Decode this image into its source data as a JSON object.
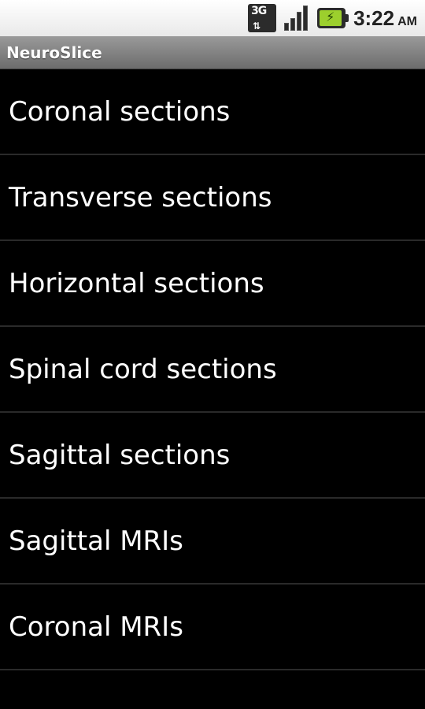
{
  "status_bar": {
    "network_label": "3G",
    "network_arrows": "⇅",
    "battery_bolt": "⚡",
    "time": "3:22",
    "ampm": "AM"
  },
  "app": {
    "title": "NeuroSlice"
  },
  "list": {
    "items": [
      {
        "label": "Coronal sections"
      },
      {
        "label": "Transverse sections"
      },
      {
        "label": "Horizontal sections"
      },
      {
        "label": "Spinal cord sections"
      },
      {
        "label": "Sagittal sections"
      },
      {
        "label": "Sagittal MRIs"
      },
      {
        "label": "Coronal MRIs"
      }
    ]
  },
  "colors": {
    "background": "#000000",
    "title_bar": "#808080",
    "battery": "#9ccf2d"
  }
}
